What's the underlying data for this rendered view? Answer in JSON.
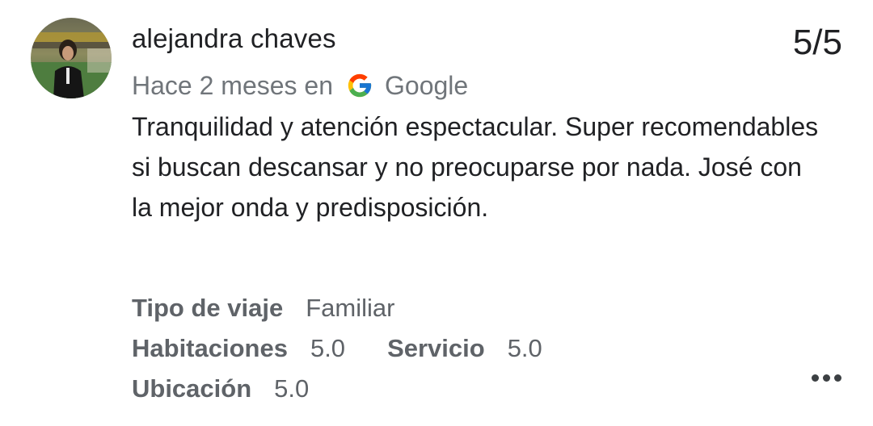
{
  "review": {
    "author": "alejandra chaves",
    "rating": "5/5",
    "time_ago": "Hace 2 meses en",
    "source": "Google",
    "source_icon": "google-g-icon",
    "text": "Tranquilidad y atención espectacular. Super recomendables si buscan descansar y no preocuparse por nada. José con la mejor onda y predisposición.",
    "attributes": {
      "trip_type": {
        "label": "Tipo de viaje",
        "value": "Familiar"
      },
      "rooms": {
        "label": "Habitaciones",
        "value": "5.0"
      },
      "service": {
        "label": "Servicio",
        "value": "5.0"
      },
      "location": {
        "label": "Ubicación",
        "value": "5.0"
      }
    },
    "more_icon": "more-horizontal-icon"
  },
  "colors": {
    "primary_text": "#202124",
    "secondary_text": "#70757a",
    "attribute_text": "#5f6368"
  }
}
